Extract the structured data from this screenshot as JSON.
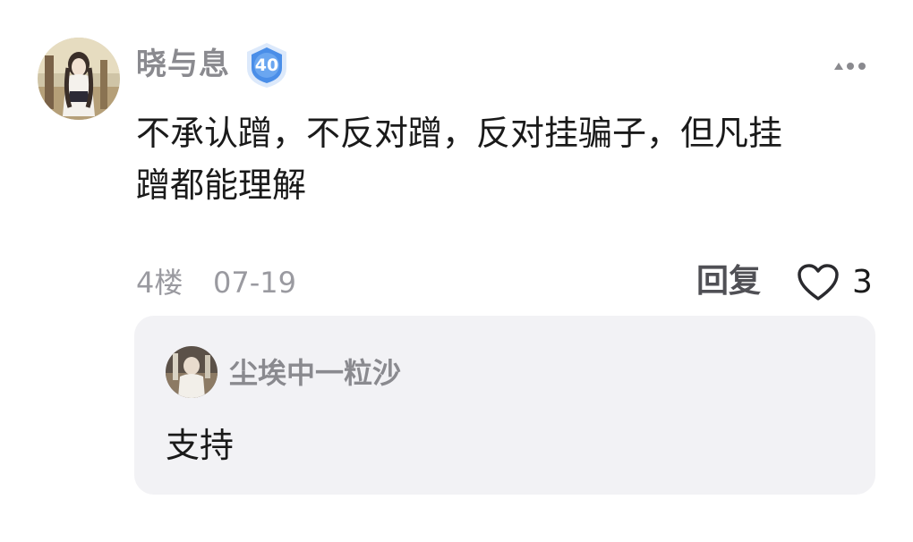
{
  "post": {
    "username": "晓与息",
    "level_badge": "40",
    "content": "不承认蹭，不反对蹭，反对挂骗子，但凡挂\n蹭都能理解",
    "floor": "4楼",
    "date": "07-19",
    "reply_label": "回复",
    "like_count": "3",
    "icons": {
      "avatar": "user-avatar-photo",
      "level_badge": "level-shield-icon",
      "more": "more-dots-icon",
      "like": "heart-outline-icon"
    }
  },
  "reply": {
    "username": "尘埃中一粒沙",
    "content": "支持",
    "icons": {
      "avatar": "user-avatar-photo"
    }
  },
  "colors": {
    "username": "#8a8a8f",
    "text": "#1a1a1a",
    "meta": "#9a9aa0",
    "reply_box_bg": "#f2f2f5",
    "badge_blue": "#4a8ee8"
  }
}
